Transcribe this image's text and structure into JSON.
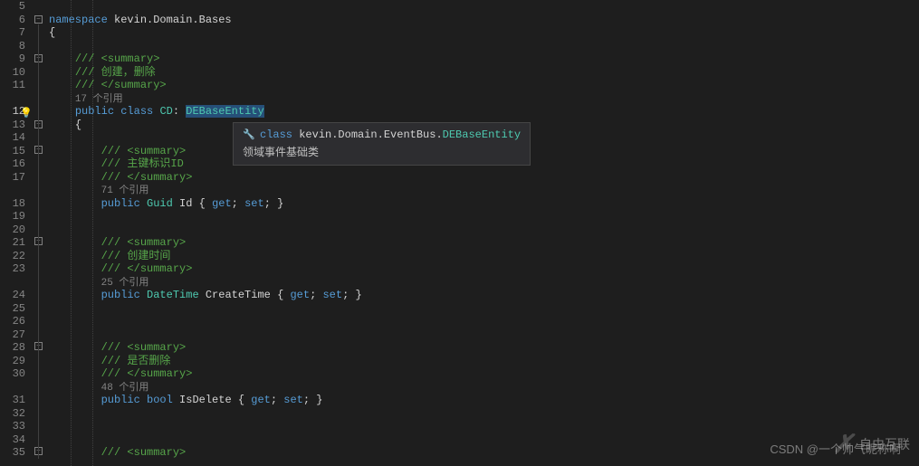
{
  "lineNumbers": [
    "5",
    "6",
    "7",
    "8",
    "9",
    "10",
    "11",
    "",
    "12",
    "13",
    "14",
    "15",
    "16",
    "17",
    "",
    "18",
    "19",
    "20",
    "21",
    "22",
    "23",
    "",
    "24",
    "25",
    "26",
    "27",
    "28",
    "29",
    "30",
    "",
    "31",
    "32",
    "33",
    "34",
    "35"
  ],
  "activeLine": 12,
  "namespace": {
    "keyword": "namespace",
    "name": "kevin.Domain.Bases"
  },
  "classDecl": {
    "summaryOpen": "/// <summary>",
    "summaryText": "/// 创建，删除",
    "summaryClose": "/// </summary>",
    "refs": "17 个引用",
    "public": "public",
    "classKw": "class",
    "name": "CD",
    "colon": ":",
    "base": "DEBaseEntity"
  },
  "prop1": {
    "summaryOpen": "/// <summary>",
    "summaryText": "/// 主键标识ID",
    "summaryClose": "/// </summary>",
    "refs": "71 个引用",
    "public": "public",
    "type": "Guid",
    "name": "Id",
    "get": "get",
    "set": "set"
  },
  "prop2": {
    "summaryOpen": "/// <summary>",
    "summaryText": "/// 创建时间",
    "summaryClose": "/// </summary>",
    "refs": "25 个引用",
    "public": "public",
    "type": "DateTime",
    "name": "CreateTime",
    "get": "get",
    "set": "set"
  },
  "prop3": {
    "summaryOpen": "/// <summary>",
    "summaryText": "/// 是否删除",
    "summaryClose": "/// </summary>",
    "refs": "48 个引用",
    "public": "public",
    "type": "bool",
    "name": "IsDelete",
    "get": "get",
    "set": "set"
  },
  "lastSummaryOpen": "/// <summary>",
  "braces": {
    "open": "{",
    "close": "}",
    "semi": ";"
  },
  "tooltip": {
    "classKw": "class",
    "ns": "kevin.Domain.EventBus.",
    "type": "DEBaseEntity",
    "desc": "领域事件基础类"
  },
  "watermark": {
    "brand": "自由互联",
    "csdn": "CSDN @一个帅气昵称啊"
  },
  "icons": {
    "lightbulb": "💡",
    "classIcon": "🔧"
  }
}
